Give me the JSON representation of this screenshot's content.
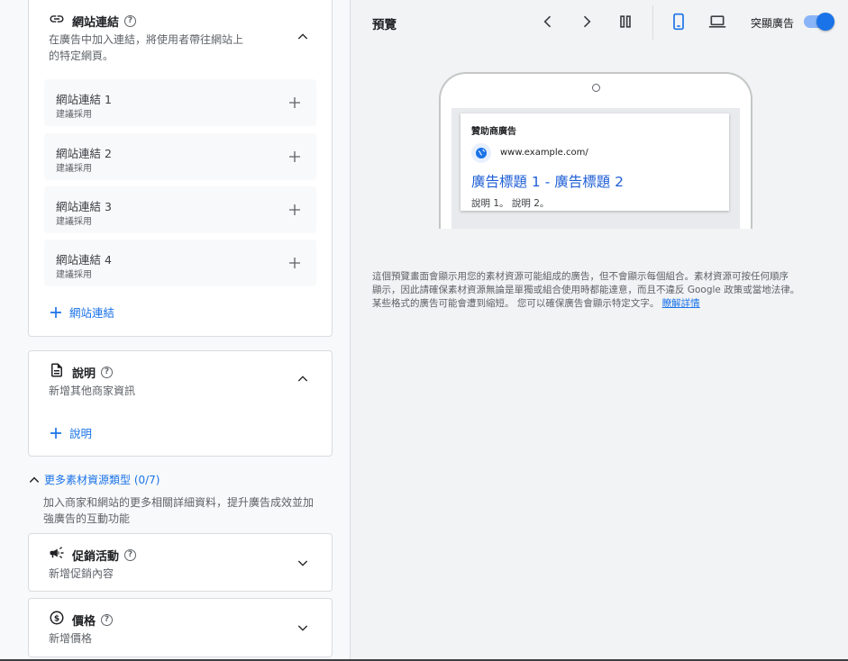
{
  "sitelinks": {
    "title": "網站連結",
    "desc_line1": "在廣告中加入連結，將使用者帶往網站上",
    "desc_line2": "的特定網頁。",
    "items": [
      {
        "name": "網站連結 1",
        "sub": "建議採用"
      },
      {
        "name": "網站連結 2",
        "sub": "建議採用"
      },
      {
        "name": "網站連結 3",
        "sub": "建議採用"
      },
      {
        "name": "網站連結 4",
        "sub": "建議採用"
      }
    ],
    "add_label": "網站連結"
  },
  "callouts": {
    "title": "說明",
    "desc": "新增其他商家資訊",
    "add_label": "說明"
  },
  "more_assets": {
    "label": "更多素材資源類型 (0/7)",
    "desc_line1": "加入商家和網站的更多相關詳細資料，提升廣告成效並加",
    "desc_line2": "強廣告的互動功能"
  },
  "promotion": {
    "title": "促銷活動",
    "desc": "新增促銷內容"
  },
  "price": {
    "title": "價格",
    "desc": "新增價格"
  },
  "preview": {
    "title": "預覽",
    "toggle_label": "突顯廣告",
    "toggle_on": true,
    "ad": {
      "label": "贊助商廣告",
      "url": "www.example.com/",
      "headline": "廣告標題 1 - 廣告標題 2",
      "description": "說明 1。 說明 2。"
    },
    "note_line1": "這個預覽畫面會顯示用您的素材資源可能組成的廣告，但不會顯示每個組合。素材資源可按任何順序",
    "note_line2": "顯示，因此請確保素材資源無論是單獨或組合使用時都能達意，而且不違反 Google 政策或當地法律。",
    "note_line3": "某些格式的廣告可能會遭到縮短。 您可以確保廣告會顯示特定文字。",
    "learn_more": "瞭解詳情"
  },
  "colors": {
    "accent": "#1a73e8",
    "border": "#dadce0",
    "panel": "#f1f3f4"
  },
  "icons": [
    "link-icon",
    "help-icon",
    "chevron-up-icon",
    "chevron-down-icon",
    "plus-icon",
    "document-icon",
    "megaphone-icon",
    "dollar-icon",
    "chevron-left-icon",
    "chevron-right-icon",
    "pause-icon",
    "phone-icon",
    "laptop-icon",
    "globe-icon"
  ]
}
